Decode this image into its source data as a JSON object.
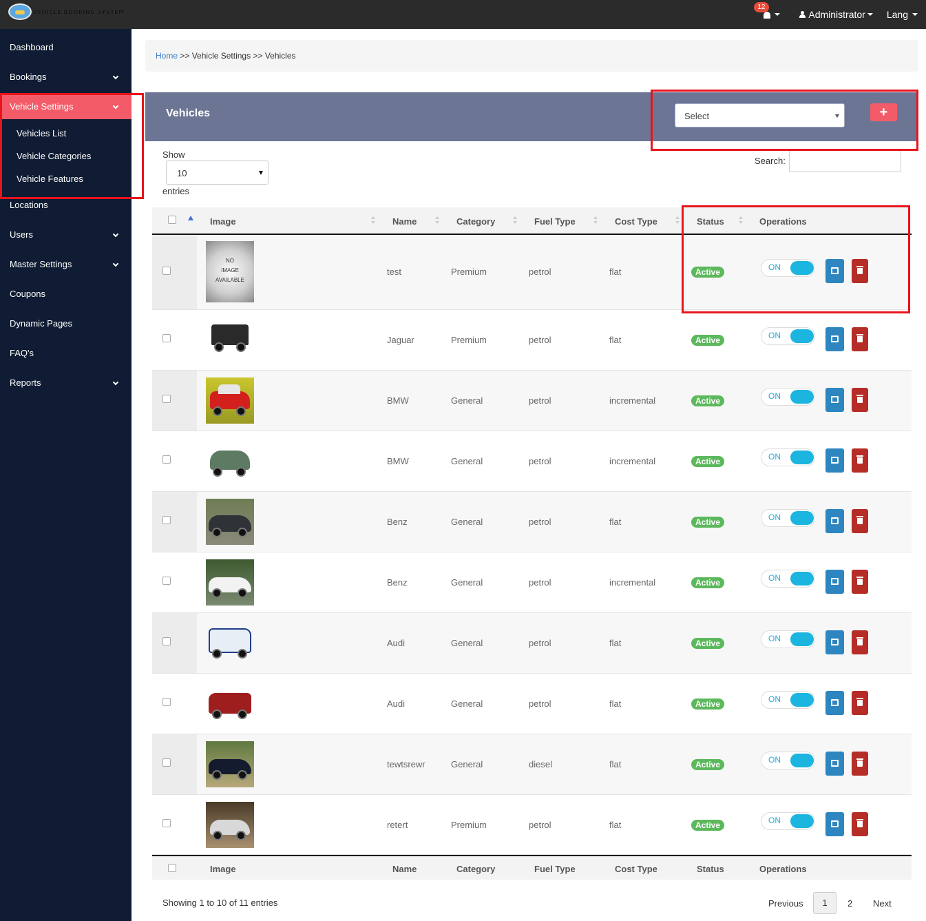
{
  "app": {
    "logo_text": "VEHICLE BOOKING SYSTEM",
    "notification_count": "12",
    "user_menu": "Administrator",
    "lang_menu": "Lang"
  },
  "sidebar": {
    "items": [
      {
        "label": "Dashboard"
      },
      {
        "label": "Bookings"
      },
      {
        "label": "Vehicle Settings"
      },
      {
        "label": "Locations"
      },
      {
        "label": "Users"
      },
      {
        "label": "Master Settings"
      },
      {
        "label": "Coupons"
      },
      {
        "label": "Dynamic Pages"
      },
      {
        "label": "FAQ's"
      },
      {
        "label": "Reports"
      }
    ],
    "sub_items": [
      {
        "label": "Vehicles List"
      },
      {
        "label": "Vehicle Categories"
      },
      {
        "label": "Vehicle Features"
      }
    ]
  },
  "breadcrumb": {
    "home": "Home",
    "sep1": ">>",
    "section": "Vehicle Settings",
    "sep2": ">>",
    "current": "Vehicles"
  },
  "panel": {
    "title": "Vehicles",
    "filter_select": "Select",
    "add_label": "+"
  },
  "table_controls": {
    "show_label": "Show",
    "page_length": "10",
    "entries_label": "entries",
    "search_label": "Search:"
  },
  "table": {
    "columns": [
      "Image",
      "Name",
      "Category",
      "Fuel Type",
      "Cost Type",
      "Status",
      "Operations"
    ],
    "toggle_label": "ON",
    "rows": [
      {
        "image": "NO IMAGE AVAILABLE",
        "name": "test",
        "category": "Premium",
        "fuel": "petrol",
        "cost": "flat",
        "status": "Active"
      },
      {
        "image": "vintage-black-car",
        "name": "Jaguar",
        "category": "Premium",
        "fuel": "petrol",
        "cost": "flat",
        "status": "Active"
      },
      {
        "image": "red-mini-car",
        "name": "BMW",
        "category": "General",
        "fuel": "petrol",
        "cost": "incremental",
        "status": "Active"
      },
      {
        "image": "green-vintage-car",
        "name": "BMW",
        "category": "General",
        "fuel": "petrol",
        "cost": "incremental",
        "status": "Active"
      },
      {
        "image": "dark-sedan",
        "name": "Benz",
        "category": "General",
        "fuel": "petrol",
        "cost": "flat",
        "status": "Active"
      },
      {
        "image": "white-roadster",
        "name": "Benz",
        "category": "General",
        "fuel": "petrol",
        "cost": "incremental",
        "status": "Active"
      },
      {
        "image": "police-van",
        "name": "Audi",
        "category": "General",
        "fuel": "petrol",
        "cost": "flat",
        "status": "Active"
      },
      {
        "image": "red-pickup",
        "name": "Audi",
        "category": "General",
        "fuel": "petrol",
        "cost": "flat",
        "status": "Active"
      },
      {
        "image": "black-sports-car",
        "name": "tewtsrewr",
        "category": "General",
        "fuel": "diesel",
        "cost": "flat",
        "status": "Active"
      },
      {
        "image": "silver-coupe",
        "name": "retert",
        "category": "Premium",
        "fuel": "petrol",
        "cost": "flat",
        "status": "Active"
      }
    ]
  },
  "footer": {
    "showing": "Showing 1 to 10 of 11 entries",
    "previous": "Previous",
    "page1": "1",
    "page2": "2",
    "next": "Next"
  },
  "colors": {
    "sidebar_bg": "#0f1c33",
    "accent": "#f45b69",
    "panel_header": "#6c7593",
    "active_badge": "#5cb85c",
    "toggle": "#1cb5e0",
    "edit_button": "#2e86c1",
    "delete_button": "#b52d26",
    "highlight_box": "#e8141c"
  }
}
